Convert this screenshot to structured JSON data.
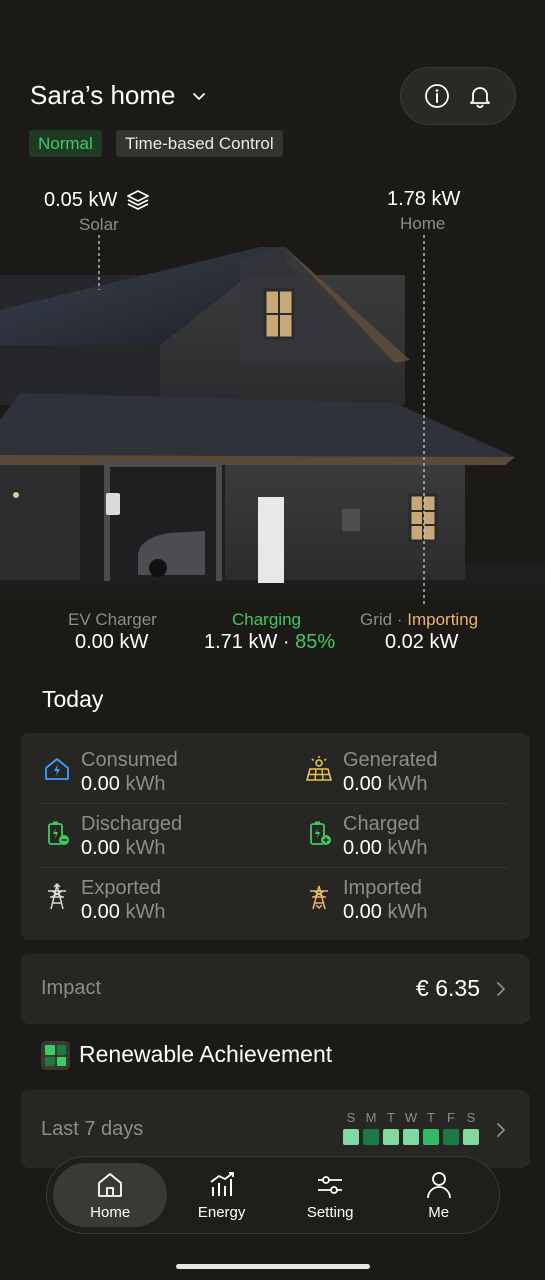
{
  "header": {
    "title": "Sara’s home",
    "badges": {
      "status": "Normal",
      "mode": "Time-based Control"
    },
    "icons": [
      "info-icon",
      "bell-icon"
    ]
  },
  "flow": {
    "solar": {
      "value": "0.05 kW",
      "label": "Solar"
    },
    "home": {
      "value": "1.78 kW",
      "label": "Home"
    },
    "ev_charger": {
      "label": "EV Charger",
      "value": "0.00 kW"
    },
    "battery": {
      "label": "Charging",
      "value": "1.71 kW",
      "separator": " · ",
      "percent": "85%"
    },
    "grid": {
      "label": "Grid",
      "separator": " · ",
      "status": "Importing",
      "value": "0.02 kW"
    }
  },
  "today": {
    "title": "Today",
    "stats": [
      {
        "label": "Consumed",
        "value": "0.00",
        "unit": "kWh",
        "icon": "home-energy-icon"
      },
      {
        "label": "Generated",
        "value": "0.00",
        "unit": "kWh",
        "icon": "solar-panel-icon"
      },
      {
        "label": "Discharged",
        "value": "0.00",
        "unit": "kWh",
        "icon": "battery-discharge-icon"
      },
      {
        "label": "Charged",
        "value": "0.00",
        "unit": "kWh",
        "icon": "battery-charge-icon"
      },
      {
        "label": "Exported",
        "value": "0.00",
        "unit": "kWh",
        "icon": "pylon-export-icon"
      },
      {
        "label": "Imported",
        "value": "0.00",
        "unit": "kWh",
        "icon": "pylon-import-icon"
      }
    ]
  },
  "impact": {
    "label": "Impact",
    "value": "€ 6.35"
  },
  "renewable": {
    "title": "Renewable Achievement",
    "period": "Last 7 days",
    "days": [
      {
        "letter": "S",
        "color": "#7fd9a0"
      },
      {
        "letter": "M",
        "color": "#1e7a45"
      },
      {
        "letter": "T",
        "color": "#7fd9a0"
      },
      {
        "letter": "W",
        "color": "#7fd9a0"
      },
      {
        "letter": "T",
        "color": "#33b86a"
      },
      {
        "letter": "F",
        "color": "#1e7a45"
      },
      {
        "letter": "S",
        "color": "#7fd9a0"
      }
    ]
  },
  "nav": {
    "items": [
      {
        "label": "Home",
        "icon": "home-icon",
        "active": true
      },
      {
        "label": "Energy",
        "icon": "chart-icon",
        "active": false
      },
      {
        "label": "Setting",
        "icon": "sliders-icon",
        "active": false
      },
      {
        "label": "Me",
        "icon": "user-icon",
        "active": false
      }
    ]
  },
  "colors": {
    "accent_green": "#3ecb63",
    "importing": "#e9b46b",
    "background": "#1b1a16",
    "card": "#272622"
  }
}
